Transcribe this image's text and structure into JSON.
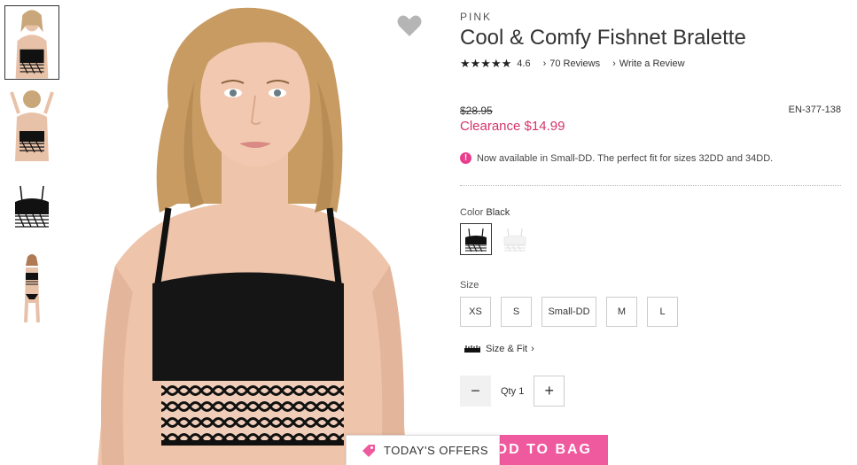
{
  "product": {
    "brand": "PINK",
    "title": "Cool & Comfy Fishnet Bralette",
    "stars": "★★★★★",
    "rating": "4.6",
    "reviews_link": "70 Reviews",
    "write_review_link": "Write a Review",
    "original_price": "$28.95",
    "sku": "EN-377-138",
    "clearance_price": "Clearance $14.99",
    "notice": "Now available in Small-DD. The perfect fit for sizes 32DD and 34DD.",
    "notice_icon": "!"
  },
  "color": {
    "label": "Color",
    "selected": "Black",
    "swatches": [
      "Black",
      "White"
    ]
  },
  "size": {
    "label": "Size",
    "options": [
      "XS",
      "S",
      "Small-DD",
      "M",
      "L"
    ]
  },
  "size_fit": {
    "label": "Size & Fit",
    "chevron": "›"
  },
  "quantity": {
    "label": "Qty",
    "value": "1",
    "minus": "−",
    "plus": "+"
  },
  "actions": {
    "add_to_bag": "DD TO BAG",
    "todays_offers": "TODAY'S OFFERS"
  },
  "icons": {
    "heart": "heart-icon",
    "chevron": "›",
    "accent_pink": "#ef5a9e",
    "clearance_color": "#d6336c"
  }
}
